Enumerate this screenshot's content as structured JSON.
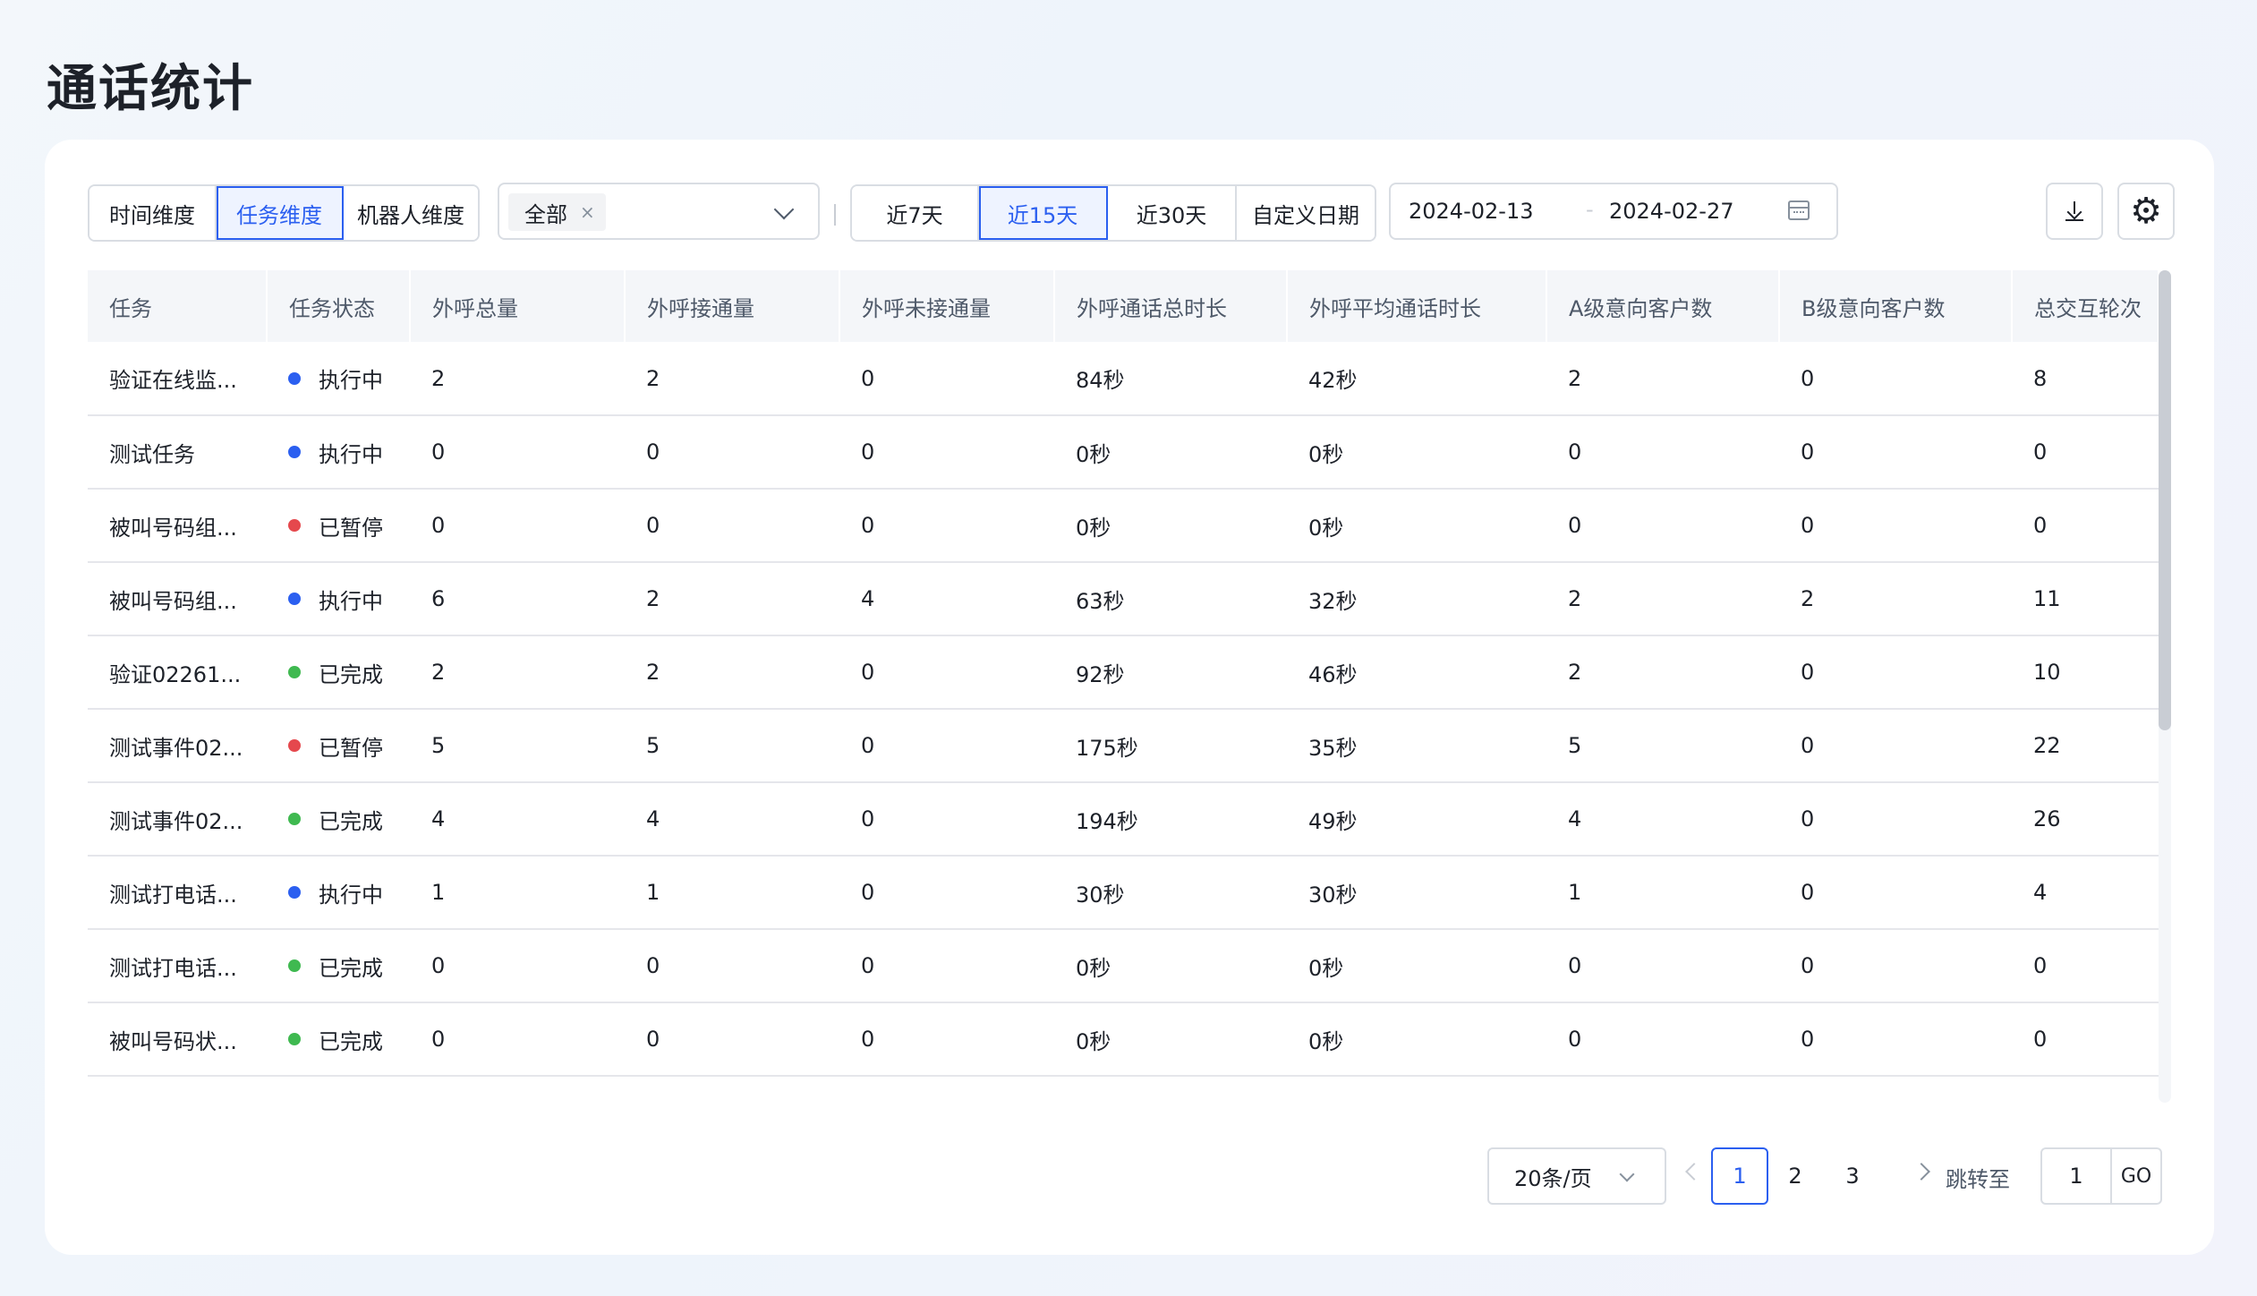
{
  "page": {
    "title": "通话统计"
  },
  "toolbar": {
    "dimensions": [
      "时间维度",
      "任务维度",
      "机器人维度"
    ],
    "dimension_active_index": 1,
    "filter_tag": "全部",
    "filter_tag_close": "×",
    "ranges": [
      "近7天",
      "近15天",
      "近30天",
      "自定义日期"
    ],
    "range_active_index": 1,
    "date_start": "2024-02-13",
    "date_sep": "-",
    "date_end": "2024-02-27",
    "icons": {
      "download": "download-icon",
      "settings": "gear-icon",
      "calendar": "calendar-icon"
    }
  },
  "table": {
    "columns": [
      "任务",
      "任务状态",
      "外呼总量",
      "外呼接通量",
      "外呼未接通量",
      "外呼通话总时长",
      "外呼平均通话时长",
      "A级意向客户数",
      "B级意向客户数",
      "总交互轮次"
    ],
    "status_colors": {
      "执行中": "#2b5ff0",
      "已暂停": "#e5484d",
      "已完成": "#3fb950"
    },
    "rows": [
      [
        "验证在线监...",
        "执行中",
        "2",
        "2",
        "0",
        "84秒",
        "42秒",
        "2",
        "0",
        "8"
      ],
      [
        "测试任务",
        "执行中",
        "0",
        "0",
        "0",
        "0秒",
        "0秒",
        "0",
        "0",
        "0"
      ],
      [
        "被叫号码组...",
        "已暂停",
        "0",
        "0",
        "0",
        "0秒",
        "0秒",
        "0",
        "0",
        "0"
      ],
      [
        "被叫号码组...",
        "执行中",
        "6",
        "2",
        "4",
        "63秒",
        "32秒",
        "2",
        "2",
        "11"
      ],
      [
        "验证02261...",
        "已完成",
        "2",
        "2",
        "0",
        "92秒",
        "46秒",
        "2",
        "0",
        "10"
      ],
      [
        "测试事件02...",
        "已暂停",
        "5",
        "5",
        "0",
        "175秒",
        "35秒",
        "5",
        "0",
        "22"
      ],
      [
        "测试事件02...",
        "已完成",
        "4",
        "4",
        "0",
        "194秒",
        "49秒",
        "4",
        "0",
        "26"
      ],
      [
        "测试打电话...",
        "执行中",
        "1",
        "1",
        "0",
        "30秒",
        "30秒",
        "1",
        "0",
        "4"
      ],
      [
        "测试打电话...",
        "已完成",
        "0",
        "0",
        "0",
        "0秒",
        "0秒",
        "0",
        "0",
        "0"
      ],
      [
        "被叫号码状...",
        "已完成",
        "0",
        "0",
        "0",
        "0秒",
        "0秒",
        "0",
        "0",
        "0"
      ]
    ]
  },
  "pagination": {
    "page_size": "20条/页",
    "pages": [
      "1",
      "2",
      "3"
    ],
    "active_page": "1",
    "jump_label": "跳转至",
    "jump_value": "1",
    "go_label": "GO"
  }
}
